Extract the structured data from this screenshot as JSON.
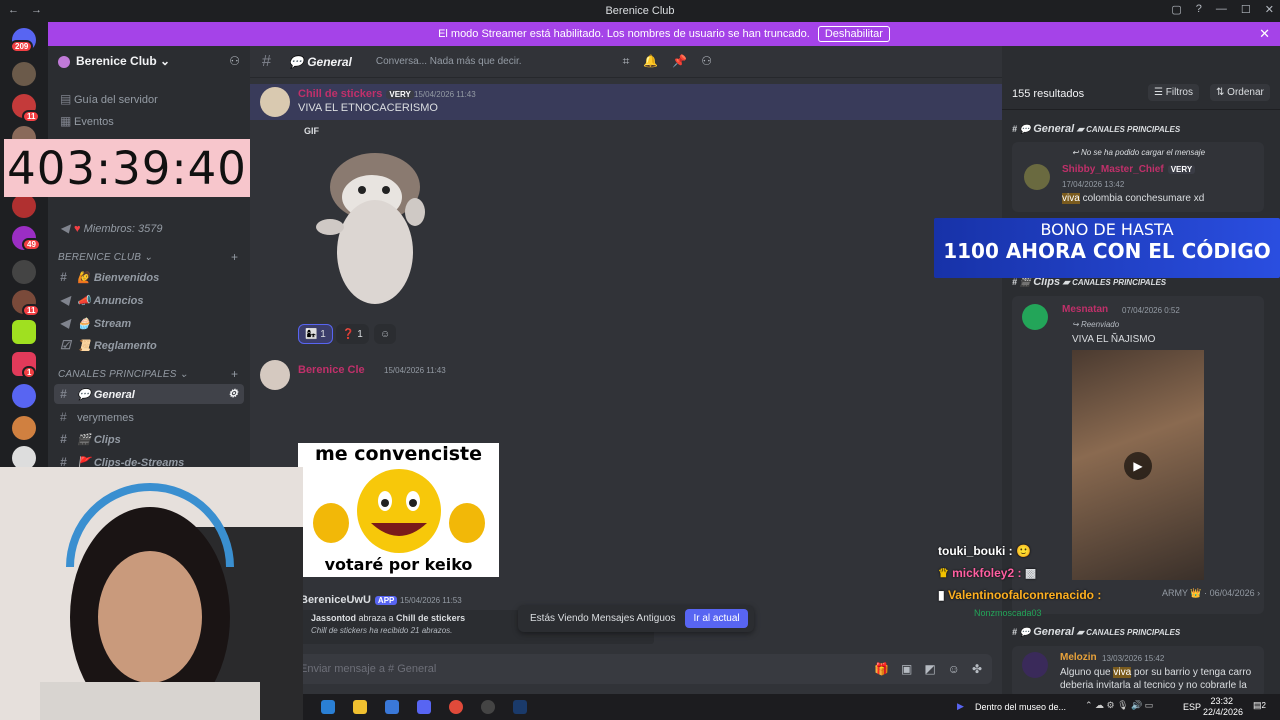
{
  "window": {
    "title": "Berenice Club",
    "back": "←",
    "forward": "→",
    "controls": [
      "▢",
      "?",
      "—",
      "☐",
      "✕"
    ]
  },
  "banner": {
    "text": "El modo Streamer está habilitado. Los nombres de usuario se han truncado.",
    "button": "Deshabilitar",
    "close": "✕"
  },
  "guilds": {
    "badges": [
      "209",
      "11",
      "11",
      "1",
      "49",
      "1",
      "11",
      "1",
      "1"
    ]
  },
  "sidebar": {
    "server_name": "Berenice Club",
    "top_items": [
      "Guía del servidor",
      "Eventos"
    ],
    "members": "Miembros: 3579",
    "category1": "BERENICE CLUB",
    "channels1": [
      "Bienvenidos",
      "Anuncios",
      "Stream",
      "Reglamento"
    ],
    "category2": "CANALES PRINCIPALES",
    "channels2": [
      "General",
      "verymemes",
      "Clips",
      "Clips-de-Streams"
    ],
    "add": "+"
  },
  "timer": "403:39:40",
  "chat": {
    "channel": "General",
    "topic": "Conversa... Nada más que decir.",
    "messages": [
      {
        "user": "Chill de stickers",
        "badge": "VERY",
        "time": "15/04/2026 11:43",
        "text": "VIVA EL ETNOCACERISMO",
        "gif_label": "GIF"
      },
      {
        "user": "Berenice Cle",
        "time": "15/04/2026 11:43",
        "image_top": "me convenciste",
        "image_bottom": "votaré por keiko"
      },
      {
        "user": "BereniceUwU",
        "badge": "APP",
        "time": "15/04/2026 11:53",
        "line1_a": "Jassontod",
        "line1_b": " abraza a ",
        "line1_c": "Chill de stickers",
        "line2": "Chill de stickers ha recibido 21 abrazos."
      }
    ],
    "reactions": [
      {
        "emoji": "👩‍👧",
        "count": "1"
      },
      {
        "emoji": "❓",
        "count": "1"
      }
    ],
    "old_messages": "Estás Viendo Mensajes Antiguos",
    "go_current": "Ir al actual",
    "composer_placeholder": "Enviar mensaje a # General"
  },
  "search": {
    "query": "viva",
    "results": "155 resultados",
    "filters": "Filtros",
    "order": "Ordenar",
    "groups": [
      {
        "channel": "General",
        "category": "CANALES PRINCIPALES",
        "reply": "No se ha podido cargar el mensaje",
        "user": "Shibby_Master_Chief",
        "badge": "VERY",
        "time": "17/04/2026 13:42",
        "highlight": "viva",
        "text": " colombia conchesumare xd"
      },
      {
        "channel": "Clips",
        "category": "CANALES PRINCIPALES",
        "user": "Mesnatan",
        "time": "07/04/2026 0:52",
        "forwarded": "Reenviado",
        "text": "VIVA EL ÑAJISMO",
        "footer_user": "Nonzmoscada03",
        "footer_tag": "ARMY",
        "footer_time": "06/04/2026"
      },
      {
        "channel": "General",
        "category": "CANALES PRINCIPALES",
        "user": "Melozin",
        "time": "13/03/2026 15:42",
        "text_a": "Alguno que ",
        "highlight": "viva",
        "text_b": " por su barrio y tenga carro deberia invitarla al tecnico y no cobrarle la"
      }
    ]
  },
  "ad": {
    "line1": "BONO DE HASTA",
    "line2": "1100 AHORA CON EL CÓDIGO"
  },
  "overlay_chat": [
    {
      "user": "touki_bouki :",
      "color": "#ffffff"
    },
    {
      "user": "mickfoley2 :",
      "color": "#ff5fa2"
    },
    {
      "user": "Valentinoofalconrenacido :",
      "color": "#ffb020"
    }
  ],
  "taskbar": {
    "media": "Dentro del museo de...",
    "lang": "ESP",
    "time": "23:32",
    "date": "22/4/2026",
    "notif": "2"
  }
}
